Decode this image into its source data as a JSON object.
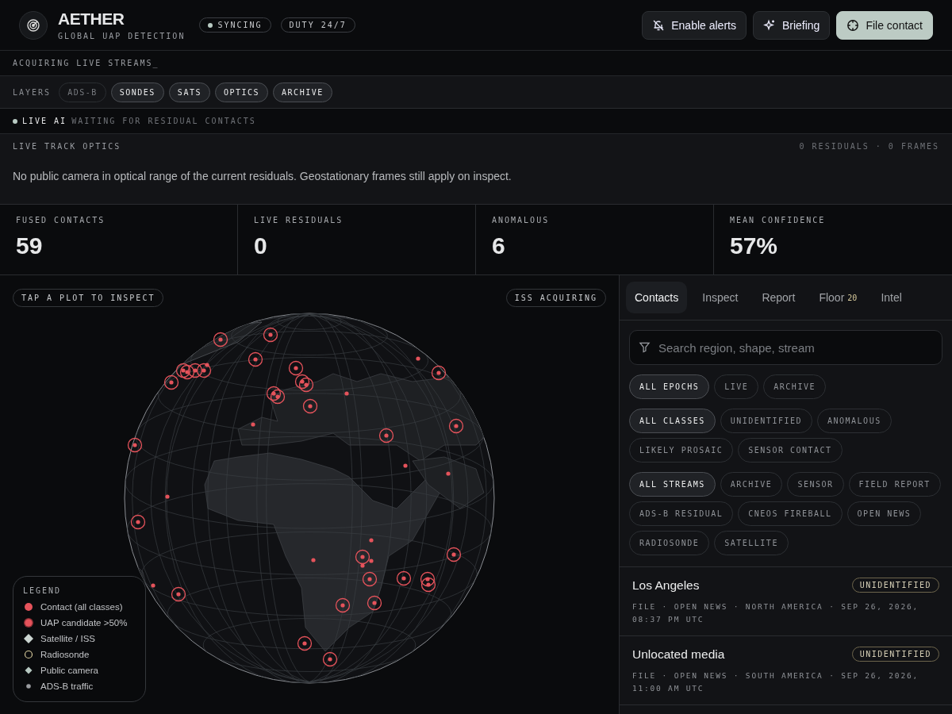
{
  "brand": {
    "name": "AETHER",
    "tagline": "GLOBAL UAP DETECTION"
  },
  "status_pills": [
    {
      "label": "SYNCING",
      "dot": true
    },
    {
      "label": "DUTY 24/7",
      "dot": false
    }
  ],
  "actions": [
    {
      "label": "Enable alerts",
      "kind": "bell-off",
      "primary": false
    },
    {
      "label": "Briefing",
      "kind": "sparkle",
      "primary": false
    },
    {
      "label": "File contact",
      "kind": "crosshair",
      "primary": true
    }
  ],
  "ticker": "ACQUIRING LIVE STREAMS_",
  "layers": {
    "label": "LAYERS",
    "items": [
      {
        "label": "ADS-B",
        "on": false
      },
      {
        "label": "SONDES",
        "on": true
      },
      {
        "label": "SATS",
        "on": true
      },
      {
        "label": "OPTICS",
        "on": true
      },
      {
        "label": "ARCHIVE",
        "on": true
      }
    ]
  },
  "live_ai": {
    "label": "LIVE AI",
    "status": "WAITING FOR RESIDUAL CONTACTS"
  },
  "optics": {
    "title": "LIVE TRACK OPTICS",
    "counts": "0 RESIDUALS · 0 FRAMES",
    "message": "No public camera in optical range of the current residuals. Geostationary frames still apply on inspect."
  },
  "stats": [
    {
      "label": "FUSED CONTACTS",
      "value": "59"
    },
    {
      "label": "LIVE RESIDUALS",
      "value": "0"
    },
    {
      "label": "ANOMALOUS",
      "value": "6"
    },
    {
      "label": "MEAN CONFIDENCE",
      "value": "57%"
    }
  ],
  "map": {
    "hint": "TAP A PLOT TO INSPECT",
    "iss": "ISS ACQUIRING",
    "legend": {
      "title": "LEGEND",
      "items": [
        {
          "label": "Contact (all classes)",
          "kind": "dot"
        },
        {
          "label": "UAP candidate >50%",
          "kind": "candidate"
        },
        {
          "label": "Satellite / ISS",
          "kind": "satellite"
        },
        {
          "label": "Radiosonde",
          "kind": "ring"
        },
        {
          "label": "Public camera",
          "kind": "camera"
        },
        {
          "label": "ADS-B traffic",
          "kind": "traffic"
        }
      ]
    }
  },
  "panel": {
    "tabs": [
      {
        "label": "Contacts",
        "selected": true
      },
      {
        "label": "Inspect",
        "selected": false
      },
      {
        "label": "Report",
        "selected": false
      },
      {
        "label": "Floor",
        "badge": "20",
        "selected": false
      },
      {
        "label": "Intel",
        "selected": false
      }
    ],
    "search": {
      "placeholder": "Search region, shape, stream"
    },
    "filter_groups": [
      [
        {
          "label": "ALL EPOCHS",
          "selected": true
        },
        {
          "label": "LIVE",
          "selected": false
        },
        {
          "label": "ARCHIVE",
          "selected": false
        }
      ],
      [
        {
          "label": "ALL CLASSES",
          "selected": true
        },
        {
          "label": "UNIDENTIFIED",
          "selected": false
        },
        {
          "label": "ANOMALOUS",
          "selected": false
        },
        {
          "label": "LIKELY PROSAIC",
          "selected": false
        },
        {
          "label": "SENSOR CONTACT",
          "selected": false
        }
      ],
      [
        {
          "label": "ALL STREAMS",
          "selected": true
        },
        {
          "label": "ARCHIVE",
          "selected": false
        },
        {
          "label": "SENSOR",
          "selected": false
        },
        {
          "label": "FIELD REPORT",
          "selected": false
        },
        {
          "label": "ADS-B RESIDUAL",
          "selected": false
        },
        {
          "label": "CNEOS FIREBALL",
          "selected": false
        },
        {
          "label": "OPEN NEWS",
          "selected": false
        },
        {
          "label": "RADIOSONDE",
          "selected": false
        },
        {
          "label": "SATELLITE",
          "selected": false
        }
      ]
    ],
    "contacts": [
      {
        "title": "Los Angeles",
        "tag": "UNIDENTIFIED",
        "meta": "FILE · OPEN NEWS · NORTH AMERICA · SEP 26, 2026, 08:37 PM UTC"
      },
      {
        "title": "Unlocated media",
        "tag": "UNIDENTIFIED",
        "meta": "FILE · OPEN NEWS · SOUTH AMERICA · SEP 26, 2026, 11:00 AM UTC"
      }
    ]
  }
}
